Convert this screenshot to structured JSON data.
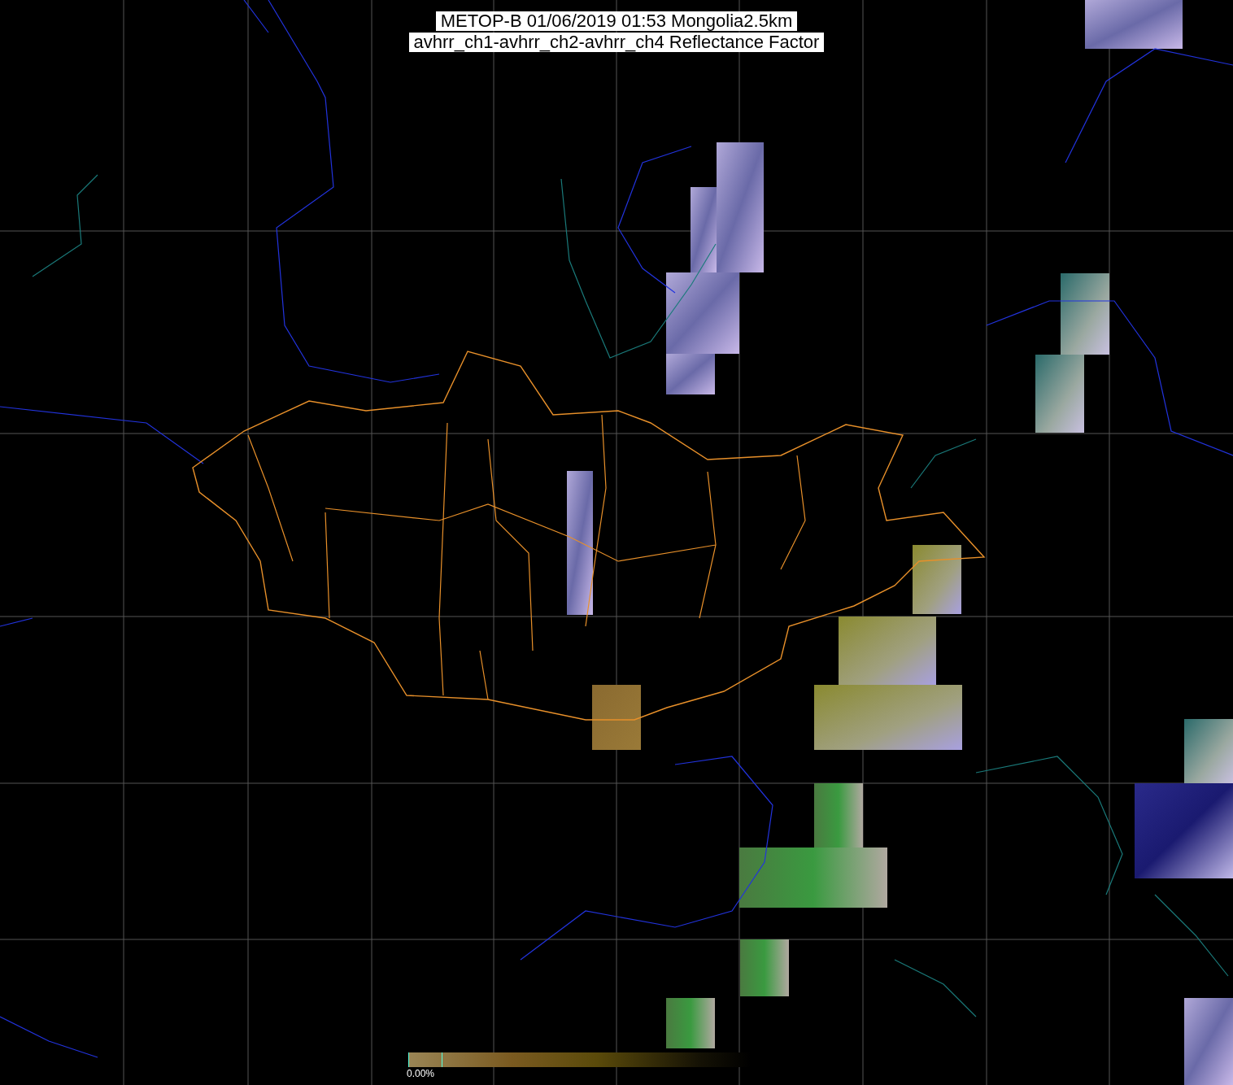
{
  "title": {
    "line_1": "METOP-B 01/06/2019 01:53 Mongolia2.5km",
    "line_2": "avhrr_ch1-avhrr_ch2-avhrr_ch4 Reflectance Factor"
  },
  "colorbar": {
    "label": "0.00%"
  }
}
